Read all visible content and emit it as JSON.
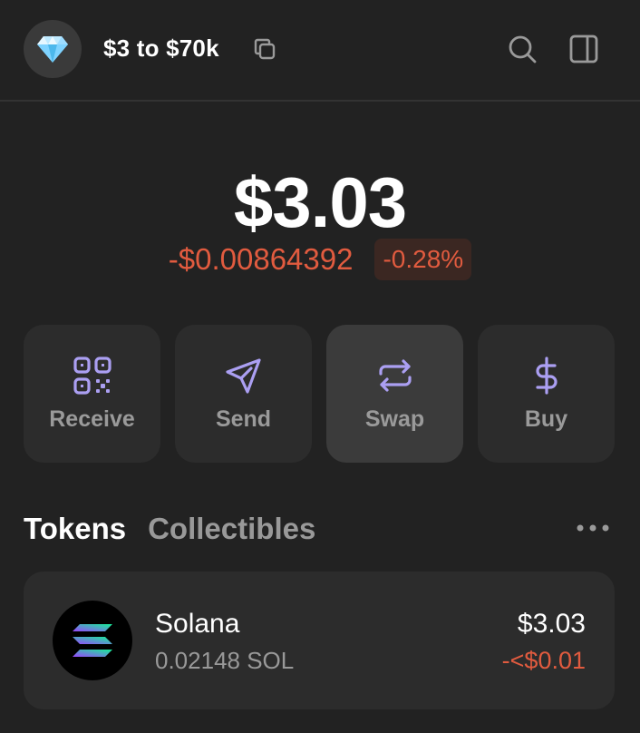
{
  "header": {
    "avatar_icon": "diamond-icon",
    "account_name": "$3 to $70k",
    "copy_icon": "copy-icon",
    "search_icon": "search-icon",
    "sidebar_icon": "sidebar-panel-icon"
  },
  "balance": {
    "total": "$3.03",
    "change_value": "-$0.00864392",
    "change_percent": "-0.28%"
  },
  "actions": [
    {
      "label": "Receive",
      "icon": "qr-code-icon"
    },
    {
      "label": "Send",
      "icon": "send-icon"
    },
    {
      "label": "Swap",
      "icon": "swap-icon"
    },
    {
      "label": "Buy",
      "icon": "dollar-icon"
    }
  ],
  "tabs": [
    {
      "label": "Tokens",
      "active": true
    },
    {
      "label": "Collectibles",
      "active": false
    }
  ],
  "tokens": [
    {
      "name": "Solana",
      "amount": "0.02148 SOL",
      "value": "$3.03",
      "change": "-<$0.01",
      "icon": "solana-logo-icon"
    }
  ],
  "colors": {
    "background": "#222222",
    "card": "#2c2c2c",
    "accent": "#ab9ff2",
    "negative": "#e15b3f"
  }
}
